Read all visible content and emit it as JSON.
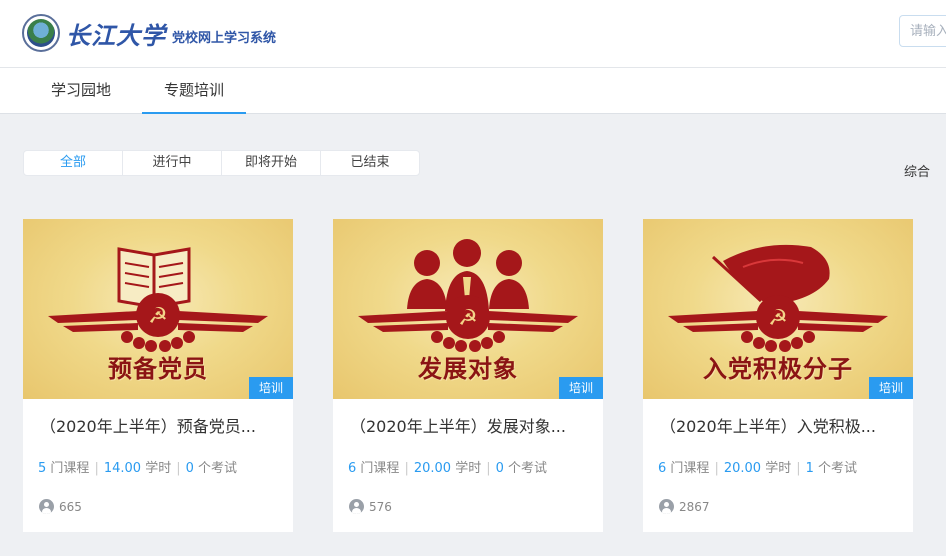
{
  "header": {
    "brand_main": "长江大学",
    "brand_sub": "党校网上学习系统",
    "search_placeholder": "请输入"
  },
  "nav": {
    "tabs": [
      {
        "label": "学习园地",
        "active": false
      },
      {
        "label": "专题培训",
        "active": true
      }
    ]
  },
  "filters": {
    "items": [
      "全部",
      "进行中",
      "即将开始",
      "已结束"
    ],
    "active": "全部"
  },
  "sort_label": "综合",
  "cards": [
    {
      "cover_text": "预备党员",
      "cover_icon": "book-icon",
      "tag": "培训",
      "title": "（2020年上半年）预备党员...",
      "courses": "5",
      "courses_unit": "门课程",
      "hours": "14.00",
      "hours_unit": "学时",
      "exams": "0",
      "exams_unit": "个考试",
      "views": "665"
    },
    {
      "cover_text": "发展对象",
      "cover_icon": "people-icon",
      "tag": "培训",
      "title": "（2020年上半年）发展对象...",
      "courses": "6",
      "courses_unit": "门课程",
      "hours": "20.00",
      "hours_unit": "学时",
      "exams": "0",
      "exams_unit": "个考试",
      "views": "576"
    },
    {
      "cover_text": "入党积极分子",
      "cover_icon": "flag-icon",
      "tag": "培训",
      "title": "（2020年上半年）入党积极...",
      "courses": "6",
      "courses_unit": "门课程",
      "hours": "20.00",
      "hours_unit": "学时",
      "exams": "1",
      "exams_unit": "个考试",
      "views": "2867"
    }
  ],
  "colors": {
    "accent": "#2a9bf0",
    "party_red": "#a5171a",
    "cover_gold": "#f0d98a"
  }
}
